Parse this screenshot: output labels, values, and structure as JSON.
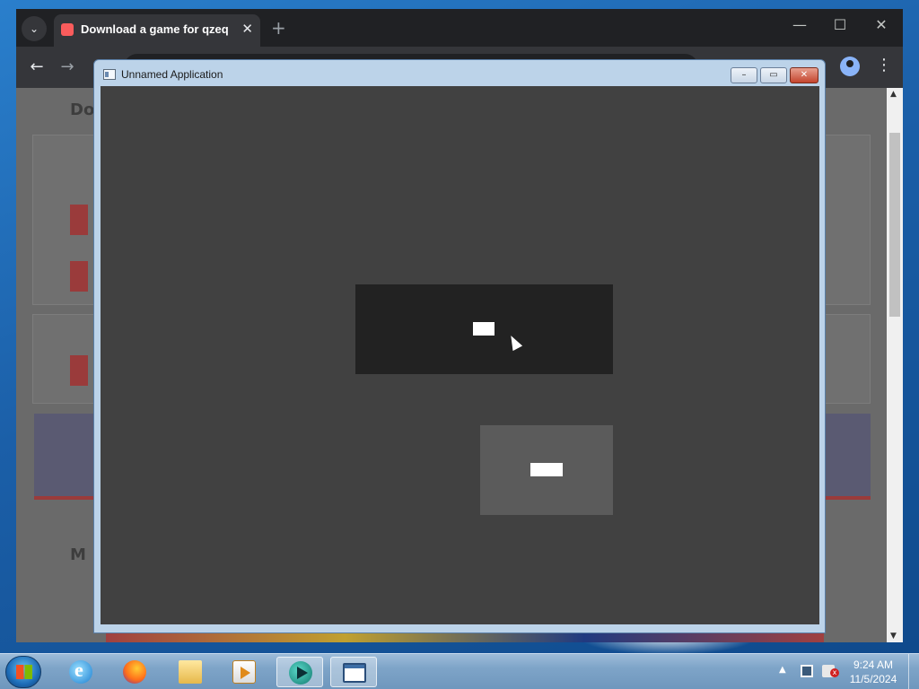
{
  "browser": {
    "tab_title": "Download a game for qzeq by",
    "tab_close": "✕",
    "new_tab": "+",
    "minimize": "—",
    "maximize": "☐",
    "close": "✕",
    "back": "←",
    "forward": "→",
    "menu": "⋮"
  },
  "webpage_ghost": {
    "heading_fragment": "Do",
    "section_fragment": "M"
  },
  "app": {
    "title": "Unnamed Application",
    "minimize": "–",
    "restore": "▭",
    "close": "✕"
  },
  "taskbar": {
    "pinned": [
      "internet-explorer",
      "firefox",
      "file-explorer",
      "media-player",
      "game-app",
      "unnamed-application"
    ],
    "tray_arrow": "▲",
    "clock": {
      "time": "9:24 AM",
      "date": "11/5/2024"
    }
  }
}
